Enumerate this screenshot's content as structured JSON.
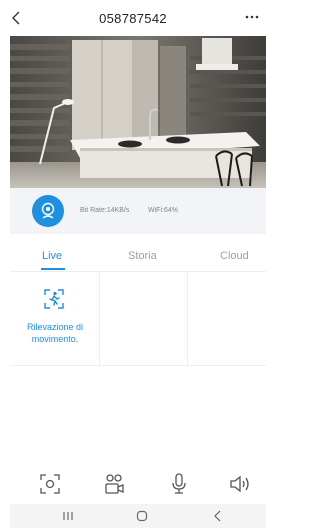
{
  "header": {
    "title": "058787542",
    "back_icon": "chevron-left-icon",
    "more_icon": "more-dots-icon"
  },
  "video": {
    "description_icon": "live-video-feed"
  },
  "status": {
    "camera_icon": "camera-icon",
    "bitrate": "Bit Rate:14KB/s",
    "wifi": "WiFi:64%"
  },
  "tabs": [
    {
      "label": "Live",
      "active": true
    },
    {
      "label": "Storia",
      "active": false
    },
    {
      "label": "Cloud",
      "active": false
    }
  ],
  "features": [
    {
      "label": "Rilevazione di movimento.",
      "icon": "motion-detection-icon"
    }
  ],
  "toolbar": {
    "snapshot_icon": "snapshot-icon",
    "users_icon": "users-video-icon",
    "mic_icon": "microphone-icon",
    "speaker_icon": "speaker-icon"
  },
  "navbar": {
    "recent_icon": "recent-apps-icon",
    "home_icon": "home-icon",
    "back_icon": "back-icon"
  },
  "colors": {
    "accent": "#1f8fe0",
    "status_bg": "#f2f4f7"
  }
}
